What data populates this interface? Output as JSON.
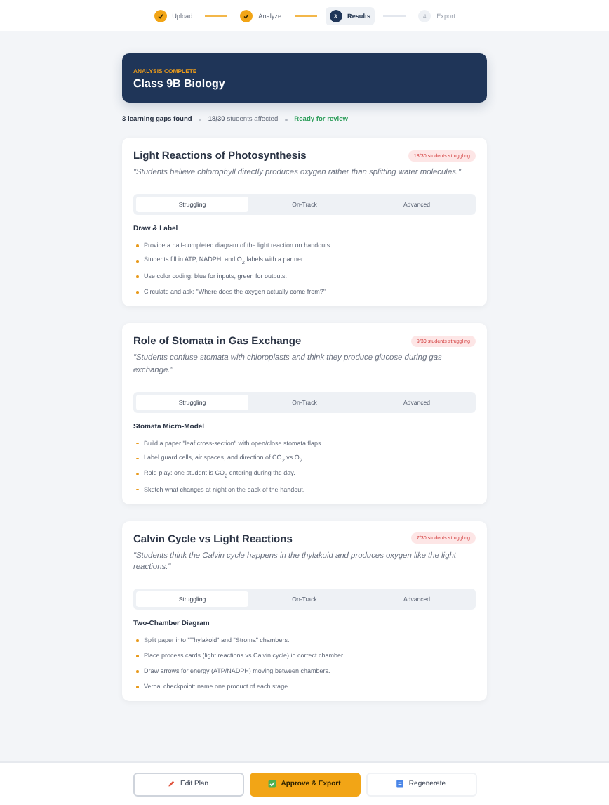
{
  "steps": [
    {
      "label": "Upload",
      "kind": "done"
    },
    {
      "label": "Analyze",
      "kind": "done"
    },
    {
      "label": "Results",
      "kind": "current",
      "number": "3"
    },
    {
      "label": "Export",
      "kind": "pending",
      "number": "4"
    }
  ],
  "header": {
    "eyebrow": "ANALYSIS COMPLETE",
    "title": "Class 9B Biology"
  },
  "summary": {
    "gaps": "3 learning gaps found",
    "affected": "**18/30** students affected",
    "status": "Ready for review"
  },
  "gaps": [
    {
      "title": "Light Reactions of Photosynthesis",
      "badge": "18/30 students struggling",
      "quote": "\"Students believe chlorophyll directly produces oxygen rather than splitting water molecules.\"",
      "tabs": [
        {
          "label": "Struggling",
          "selected": true
        },
        {
          "label": "On-Track",
          "selected": false
        },
        {
          "label": "Advanced",
          "selected": false
        }
      ],
      "activity": "Draw & Label",
      "steps": [
        "Provide a half-completed diagram of the light reaction on handouts.",
        "Students fill in ATP, NADPH, and O$_{2}$ labels with a partner.",
        "Use color coding: blue for inputs, green for outputs.",
        "Circulate and ask: \"Where does the oxygen actually come from?\""
      ]
    },
    {
      "title": "Role of Stomata in Gas Exchange",
      "badge": "9/30 students struggling",
      "quote": "\"Students confuse stomata with chloroplasts and think they produce glucose during gas exchange.\"",
      "tabs": [
        {
          "label": "Struggling",
          "selected": true
        },
        {
          "label": "On-Track",
          "selected": false
        },
        {
          "label": "Advanced",
          "selected": false
        }
      ],
      "activity": "Stomata Micro-Model",
      "steps": [
        "Build a paper \"leaf cross-section\" with open/close stomata flaps.",
        "Label guard cells, air spaces, and direction of CO$_{2}$ vs O$_{2}$.",
        "Role-play: one student is CO$_{2}$ entering during the day.",
        "Sketch what changes at night on the back of the handout."
      ]
    },
    {
      "title": "Calvin Cycle vs Light Reactions",
      "badge": "7/30 students struggling",
      "quote": "\"Students think the Calvin cycle happens in the thylakoid and produces oxygen like the light reactions.\"",
      "tabs": [
        {
          "label": "Struggling",
          "selected": true
        },
        {
          "label": "On-Track",
          "selected": false
        },
        {
          "label": "Advanced",
          "selected": false
        }
      ],
      "activity": "Two-Chamber Diagram",
      "steps": [
        "Split paper into \"Thylakoid\" and \"Stroma\" chambers.",
        "Place process cards (light reactions vs Calvin cycle) in correct chamber.",
        "Draw arrows for energy (ATP/NADPH) moving between chambers.",
        "Verbal checkpoint: name one product of each stage."
      ]
    }
  ],
  "actions": [
    {
      "label": "Edit Plan",
      "kind": "secondary"
    },
    {
      "label": "Approve & Export",
      "kind": "primary"
    },
    {
      "label": "Regenerate",
      "kind": "ghost"
    }
  ]
}
